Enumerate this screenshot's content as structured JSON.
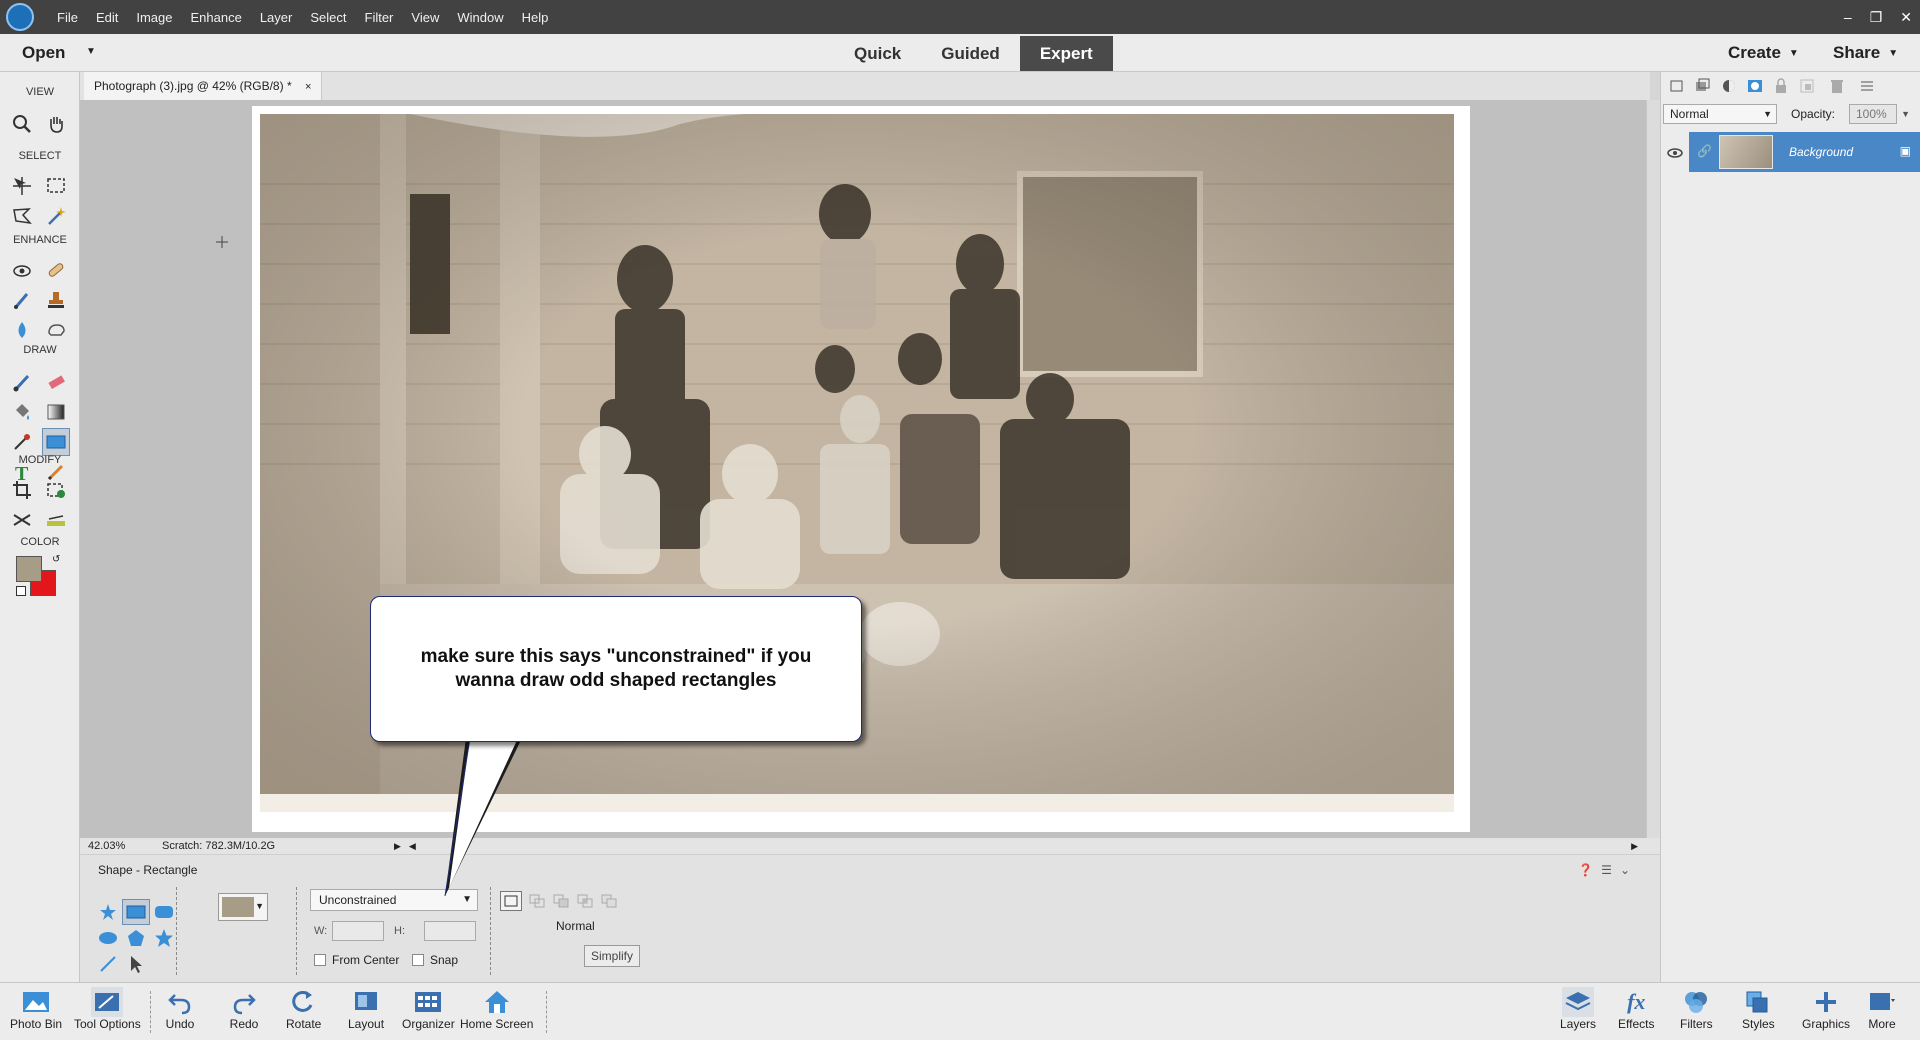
{
  "menubar": {
    "items": [
      "File",
      "Edit",
      "Image",
      "Enhance",
      "Layer",
      "Select",
      "Filter",
      "View",
      "Window",
      "Help"
    ]
  },
  "modebar": {
    "open_label": "Open",
    "tabs": [
      {
        "label": "Quick"
      },
      {
        "label": "Guided"
      },
      {
        "label": "Expert",
        "active": true
      }
    ],
    "create_label": "Create",
    "share_label": "Share"
  },
  "toolbox": {
    "sections": {
      "view": "VIEW",
      "select": "SELECT",
      "enhance": "ENHANCE",
      "draw": "DRAW",
      "modify": "MODIFY",
      "color": "COLOR"
    },
    "foreground_color": "#a79c86",
    "background_color": "#e3161c"
  },
  "document": {
    "tab_title": "Photograph (3).jpg @ 42% (RGB/8) *",
    "close_glyph": "×",
    "zoom": "42.03%",
    "scratch": "Scratch: 782.3M/10.2G"
  },
  "tool_options": {
    "title": "Shape - Rectangle",
    "shape_color": "#a79c86",
    "constraint": "Unconstrained",
    "w_label": "W:",
    "h_label": "H:",
    "from_center_label": "From Center",
    "snap_label": "Snap",
    "mode_label": "Normal",
    "simplify_label": "Simplify"
  },
  "layers_panel": {
    "blend_mode": "Normal",
    "opacity_label": "Opacity:",
    "opacity_value": "100%",
    "layer_name": "Background"
  },
  "bottombar": {
    "photo_bin": "Photo Bin",
    "tool_options": "Tool Options",
    "undo": "Undo",
    "redo": "Redo",
    "rotate": "Rotate",
    "layout": "Layout",
    "organizer": "Organizer",
    "home_screen": "Home Screen",
    "layers": "Layers",
    "effects": "Effects",
    "filters": "Filters",
    "styles": "Styles",
    "graphics": "Graphics",
    "more": "More"
  },
  "callout": {
    "text": "make sure this says \"unconstrained\" if you wanna draw odd shaped rectangles"
  }
}
